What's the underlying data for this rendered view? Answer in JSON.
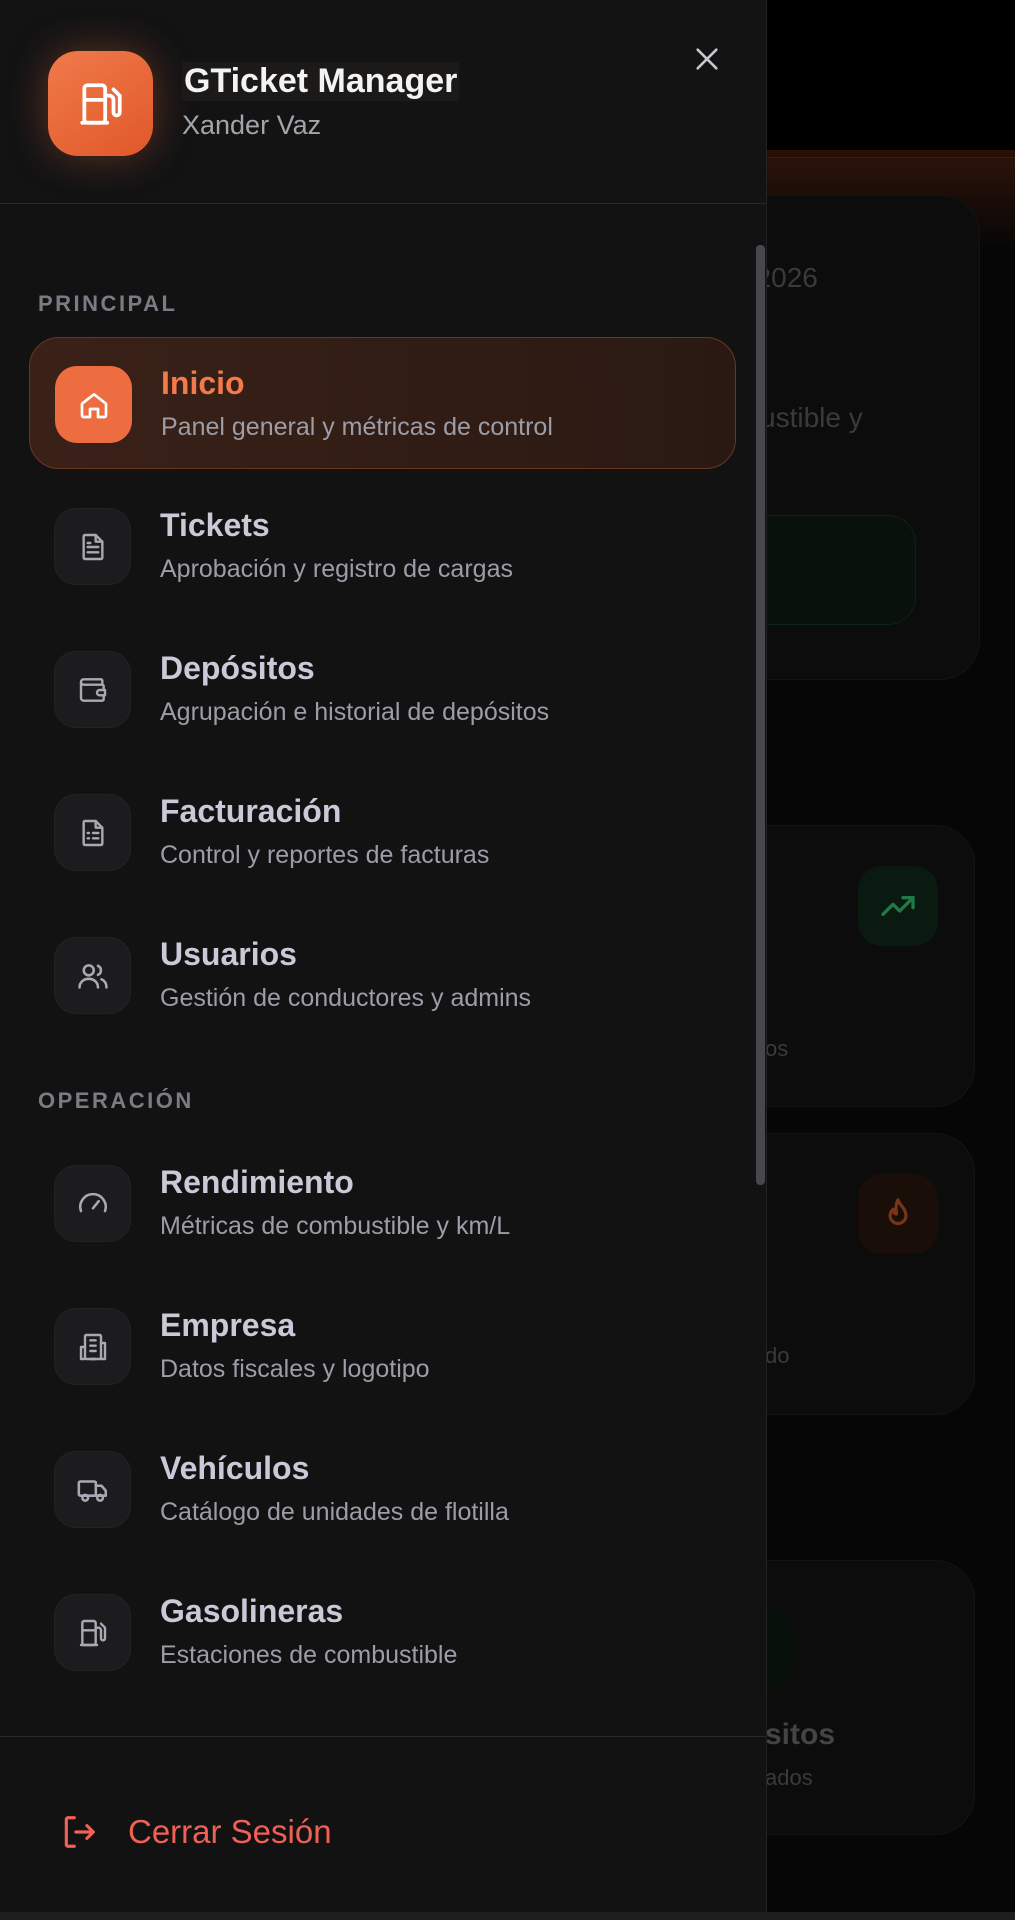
{
  "brand": {
    "title": "GTicket Manager",
    "subtitle": "Xander Vaz",
    "logo_icon": "fuel-pump-icon",
    "accent_color": "#ee6d40"
  },
  "background": {
    "date_fragment": ", 2026",
    "desc_fragment": "ustible y",
    "card1_fragment": "os",
    "card2_fragment": "do",
    "card3_title_fragment": "sitos",
    "card3_sub_fragment": "ados"
  },
  "sections": [
    {
      "label": "PRINCIPAL"
    },
    {
      "label": "OPERACIÓN"
    }
  ],
  "nav": [
    {
      "title": "Inicio",
      "desc": "Panel general y métricas de control",
      "icon": "home-icon",
      "active": true
    },
    {
      "title": "Tickets",
      "desc": "Aprobación y registro de cargas",
      "icon": "document-icon"
    },
    {
      "title": "Depósitos",
      "desc": "Agrupación e historial de depósitos",
      "icon": "wallet-icon"
    },
    {
      "title": "Facturación",
      "desc": "Control y reportes de facturas",
      "icon": "invoice-icon"
    },
    {
      "title": "Usuarios",
      "desc": "Gestión de conductores y admins",
      "icon": "users-icon"
    },
    {
      "title": "Rendimiento",
      "desc": "Métricas de combustible y km/L",
      "icon": "gauge-icon"
    },
    {
      "title": "Empresa",
      "desc": "Datos fiscales y logotipo",
      "icon": "building-icon"
    },
    {
      "title": "Vehículos",
      "desc": "Catálogo de unidades de flotilla",
      "icon": "truck-icon"
    },
    {
      "title": "Gasolineras",
      "desc": "Estaciones de combustible",
      "icon": "fuel-pump-icon"
    }
  ],
  "footer": {
    "logout_label": "Cerrar Sesión",
    "logout_color": "#f15f55"
  }
}
